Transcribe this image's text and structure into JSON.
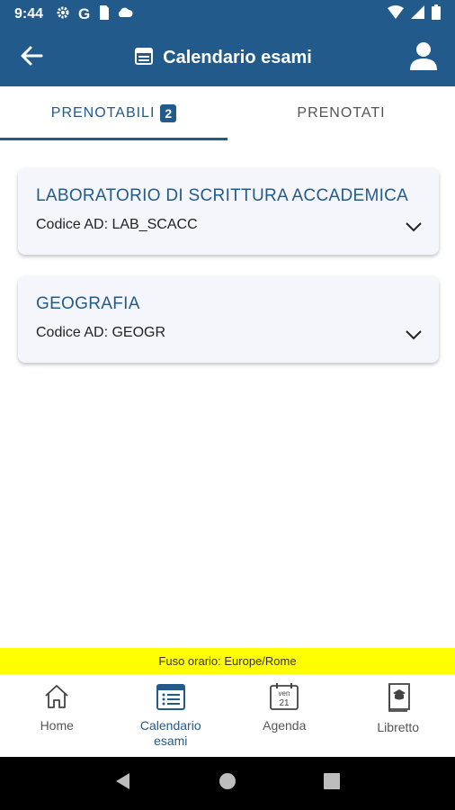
{
  "status_bar": {
    "time": "9:44",
    "left_icons": [
      "gear-icon",
      "google-icon",
      "sim-card-icon",
      "cloud-icon"
    ],
    "right_icons": [
      "wifi-icon",
      "signal-icon",
      "battery-icon"
    ],
    "google_letter": "G"
  },
  "app_bar": {
    "title": "Calendario esami",
    "back_icon": "arrow-left-icon",
    "title_icon": "calendar-icon",
    "account_icon": "person-icon"
  },
  "tabs": [
    {
      "label": "PRENOTABILI",
      "badge": "2",
      "active": true
    },
    {
      "label": "PRENOTATI",
      "active": false
    }
  ],
  "exams": [
    {
      "title": "LABORATORIO DI SCRITTURA ACCADEMICA",
      "code": "Codice AD: LAB_SCACC"
    },
    {
      "title": "GEOGRAFIA",
      "code": "Codice AD: GEOGR"
    }
  ],
  "timezone": "Fuso orario: Europe/Rome",
  "bottom_nav": [
    {
      "label": "Home",
      "icon": "home-icon",
      "active": false
    },
    {
      "label": "Calendario",
      "label2": "esami",
      "icon": "calendar-list-icon",
      "active": true
    },
    {
      "label": "Agenda",
      "icon": "agenda-calendar-icon",
      "day_abbr": "ven",
      "day_num": "21",
      "active": false
    },
    {
      "label": "Libretto",
      "icon": "booklet-icon",
      "active": false
    }
  ],
  "colors": {
    "primary": "#235a8c",
    "timezone_bg": "#ffff00",
    "card_bg": "#f4f6fb"
  }
}
